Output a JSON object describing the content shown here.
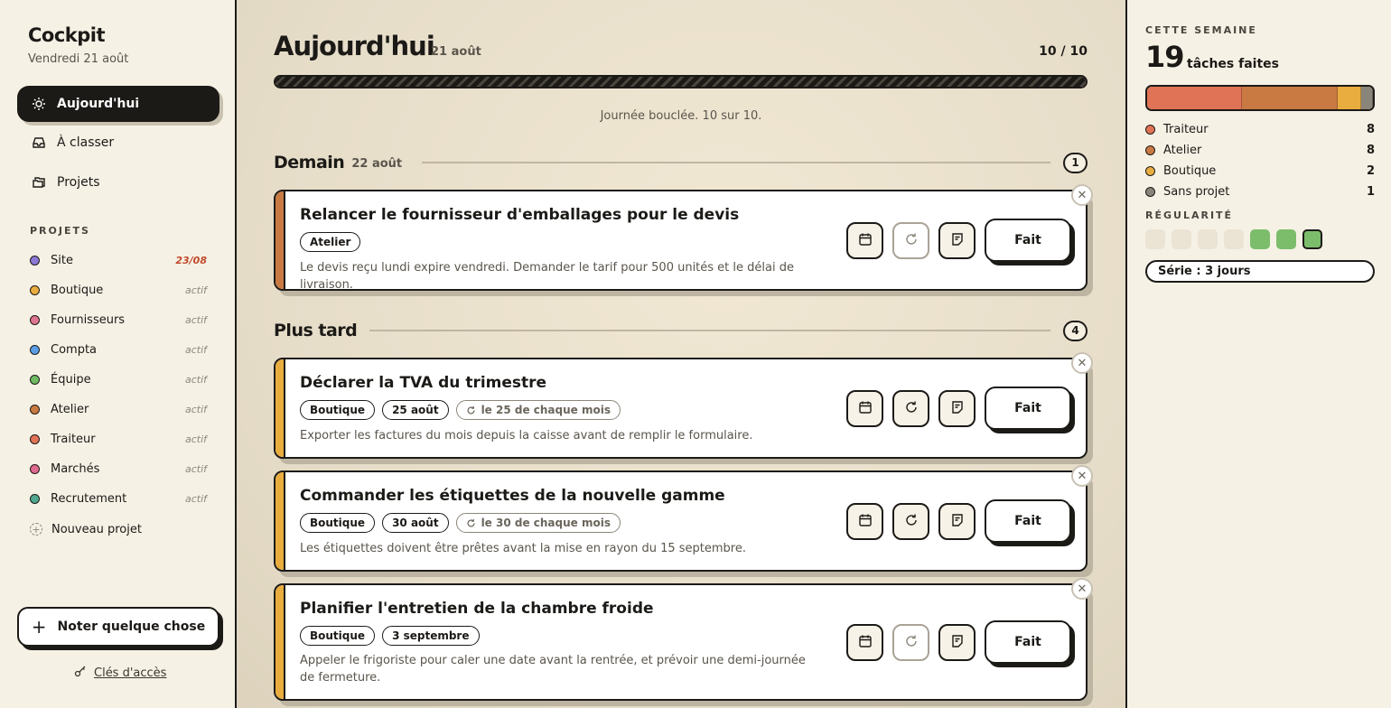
{
  "sidebar": {
    "brand": "Cockpit",
    "date": "Vendredi 21 août",
    "nav": [
      {
        "label": "Aujourd'hui",
        "icon": "sun-icon",
        "active": true
      },
      {
        "label": "À classer",
        "icon": "inbox-icon",
        "active": false
      },
      {
        "label": "Projets",
        "icon": "folders-icon",
        "active": false
      }
    ],
    "projects_title": "PROJETS",
    "projects": [
      {
        "name": "Site",
        "status": "23/08",
        "color": "#8b78d6",
        "due": true
      },
      {
        "name": "Boutique",
        "status": "actif",
        "color": "#e9ad3f",
        "due": false
      },
      {
        "name": "Fournisseurs",
        "status": "actif",
        "color": "#e07593",
        "due": false
      },
      {
        "name": "Compta",
        "status": "actif",
        "color": "#5a9ee6",
        "due": false
      },
      {
        "name": "Équipe",
        "status": "actif",
        "color": "#6fbb62",
        "due": false
      },
      {
        "name": "Atelier",
        "status": "actif",
        "color": "#c97a42",
        "due": false
      },
      {
        "name": "Traiteur",
        "status": "actif",
        "color": "#e07355",
        "due": false
      },
      {
        "name": "Marchés",
        "status": "actif",
        "color": "#e0698f",
        "due": false
      },
      {
        "name": "Recrutement",
        "status": "actif",
        "color": "#4fa88f",
        "due": false
      }
    ],
    "new_project": "Nouveau projet",
    "note_button": "Noter quelque chose",
    "keys_link": "Clés d'accès"
  },
  "main": {
    "title": "Aujourd'hui",
    "date": "21 août",
    "count": "10 / 10",
    "progress": 1.0,
    "progress_message": "Journée bouclée. 10 sur 10.",
    "groups": [
      {
        "title": "Demain",
        "date": "22 août",
        "count": "1"
      },
      {
        "title": "Plus tard",
        "date": "",
        "count": "4"
      }
    ],
    "done_label": "Fait",
    "tasks": [
      {
        "title": "Relancer le fournisseur d'emballages pour le devis",
        "stripe": "#c97a42",
        "chips": [
          "Atelier"
        ],
        "recurrence": "",
        "description": "Le devis reçu lundi expire vendredi. Demander le tarif pour 500 unités et le délai de livraison.",
        "recurring": false
      },
      {
        "title": "Déclarer la TVA du trimestre",
        "stripe": "#e9ad3f",
        "chips": [
          "Boutique",
          "25 août"
        ],
        "recurrence": "le 25 de chaque mois",
        "description": "Exporter les factures du mois depuis la caisse avant de remplir le formulaire.",
        "recurring": true
      },
      {
        "title": "Commander les étiquettes de la nouvelle gamme",
        "stripe": "#e9ad3f",
        "chips": [
          "Boutique",
          "30 août"
        ],
        "recurrence": "le 30 de chaque mois",
        "description": "Les étiquettes doivent être prêtes avant la mise en rayon du 15 septembre.",
        "recurring": true
      },
      {
        "title": "Planifier l'entretien de la chambre froide",
        "stripe": "#e9ad3f",
        "chips": [
          "Boutique",
          "3 septembre"
        ],
        "recurrence": "",
        "description": "Appeler le frigoriste pour caler une date avant la rentrée, et prévoir une demi-journée de fermeture.",
        "recurring": false
      }
    ]
  },
  "week": {
    "title": "CETTE SEMAINE",
    "total": "19",
    "subtitle": "tâches faites",
    "breakdown": [
      {
        "name": "Traiteur",
        "count": "8",
        "value": 8,
        "color": "#e07355"
      },
      {
        "name": "Atelier",
        "count": "8",
        "value": 8,
        "color": "#c97a42"
      },
      {
        "name": "Boutique",
        "count": "2",
        "value": 2,
        "color": "#e9ad3f"
      },
      {
        "name": "Sans projet",
        "count": "1",
        "value": 1,
        "color": "#8a857b"
      }
    ],
    "regularity_title": "RÉGULARITÉ",
    "regularity": [
      false,
      false,
      false,
      false,
      true,
      true,
      true
    ],
    "streak": "Série : 3 jours"
  }
}
